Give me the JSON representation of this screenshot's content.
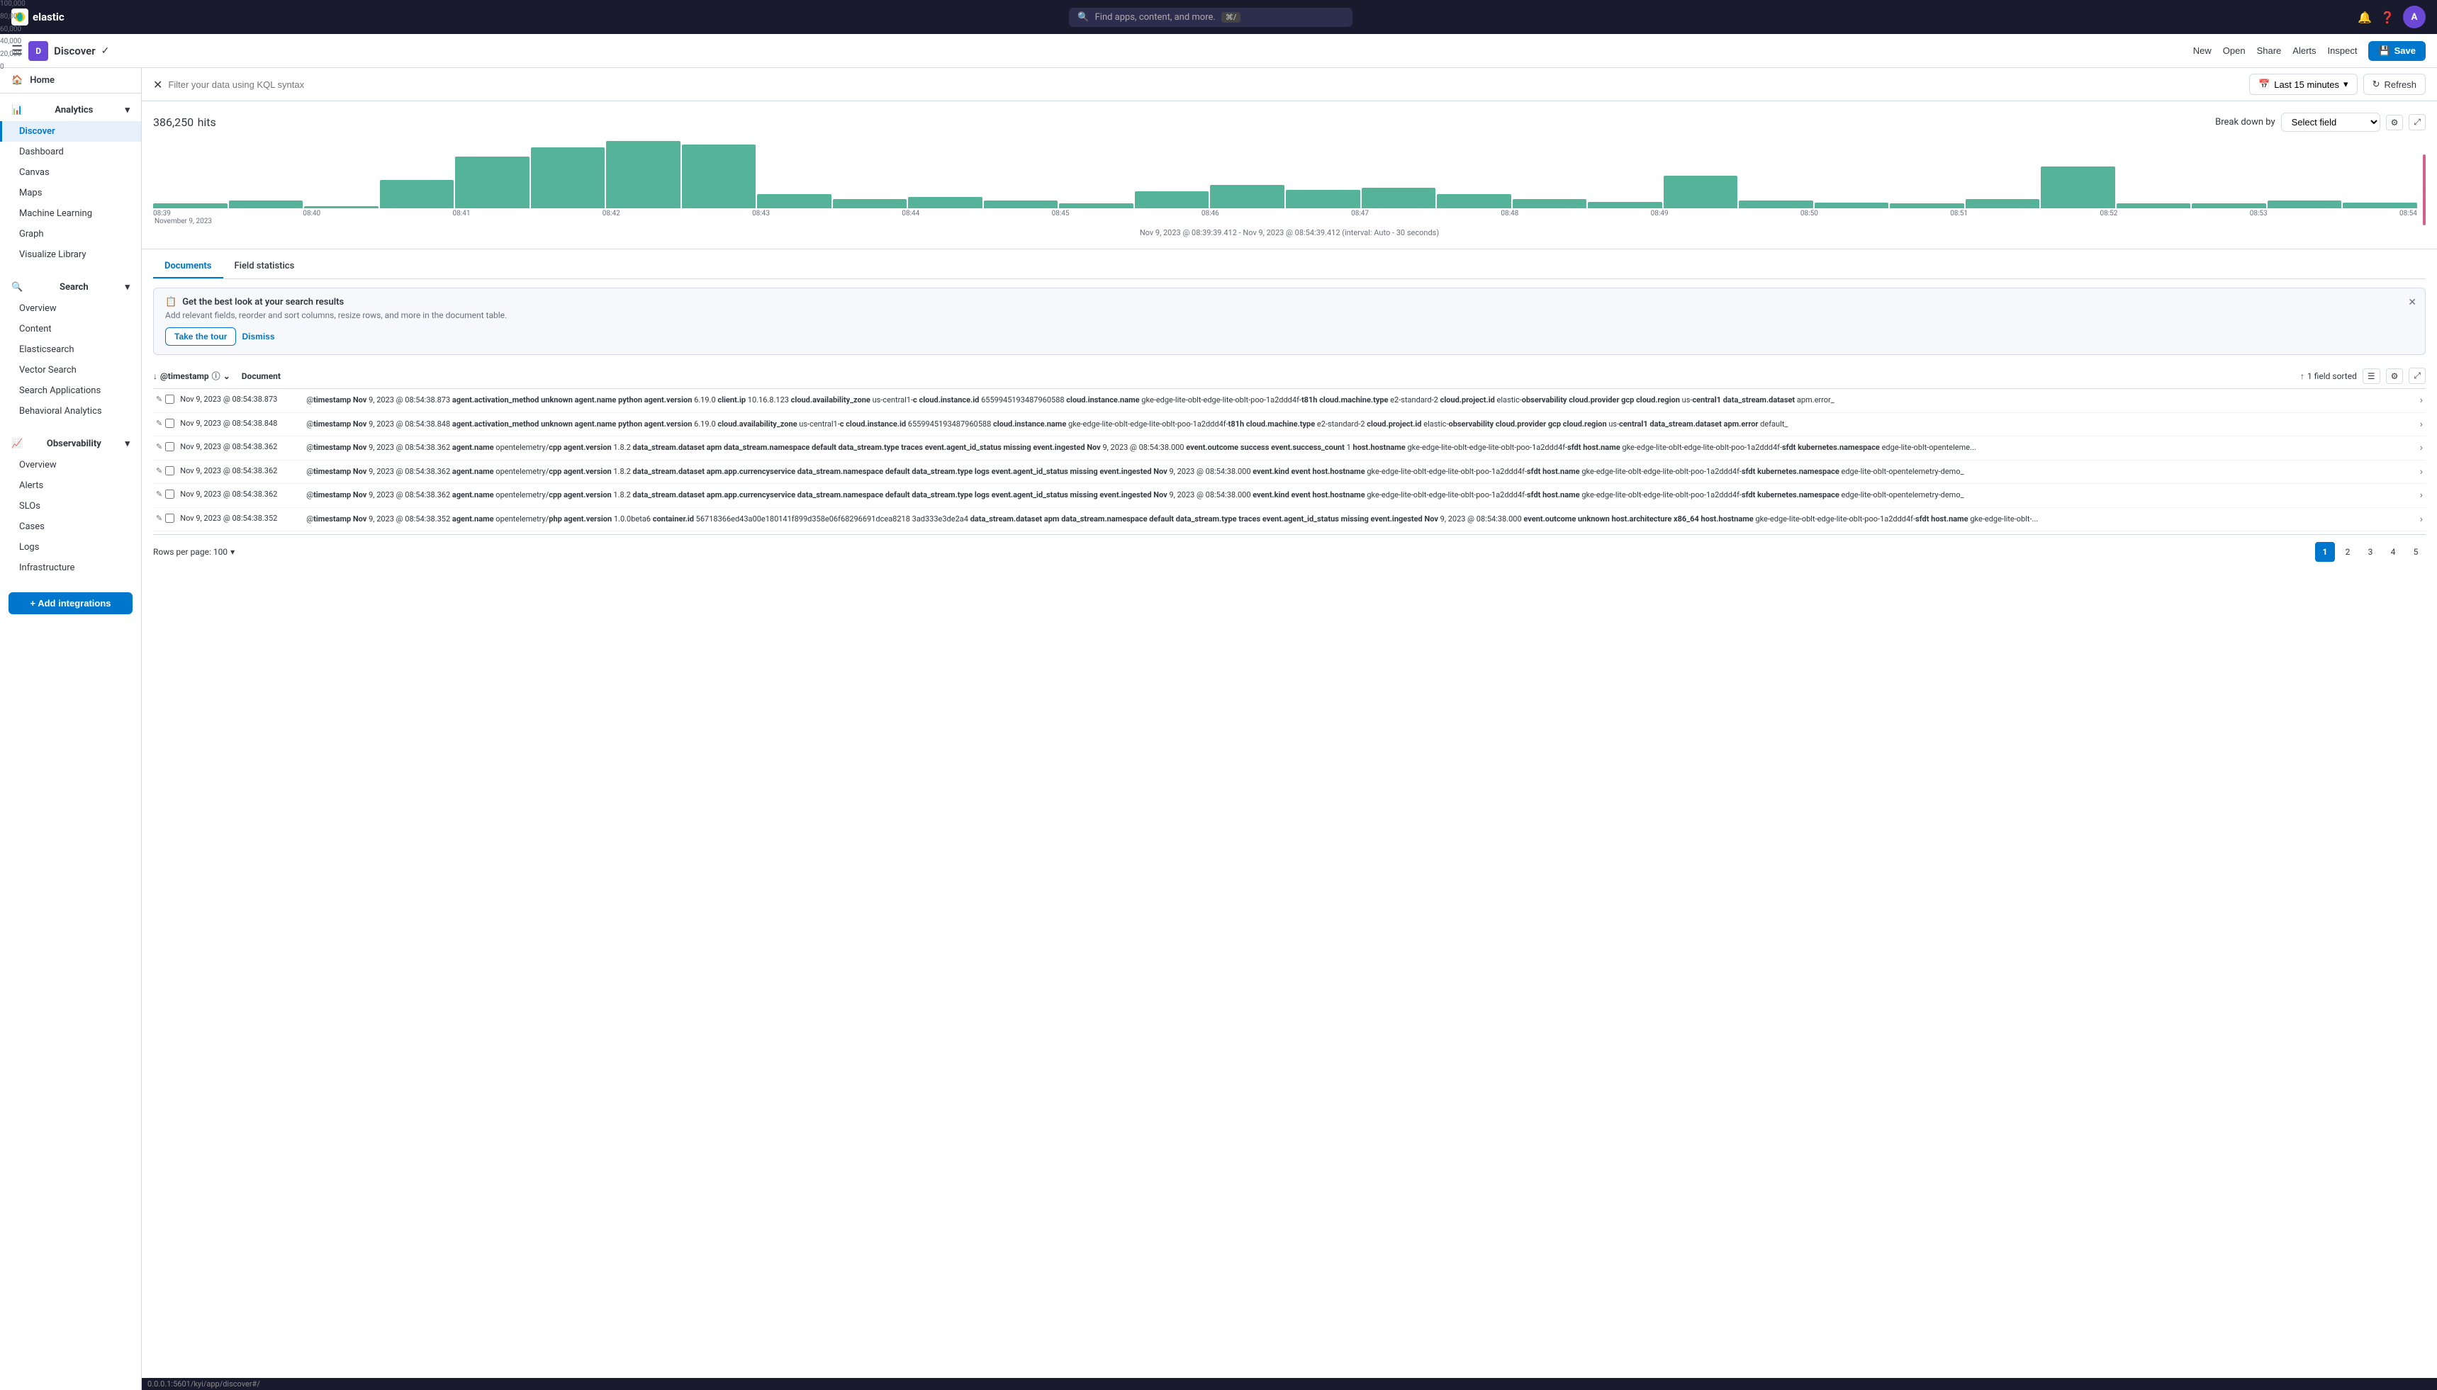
{
  "globalNav": {
    "logoText": "elastic",
    "searchPlaceholder": "Find apps, content, and more.",
    "searchShortcut": "⌘/",
    "avatarInitial": "A"
  },
  "appNav": {
    "avatarInitial": "D",
    "appName": "Discover",
    "actions": {
      "new": "New",
      "open": "Open",
      "share": "Share",
      "alerts": "Alerts",
      "inspect": "Inspect",
      "save": "Save"
    }
  },
  "sidebar": {
    "homeLabel": "Home",
    "sections": [
      {
        "name": "Analytics",
        "items": [
          "Discover",
          "Dashboard",
          "Canvas",
          "Maps",
          "Machine Learning",
          "Graph",
          "Visualize Library"
        ]
      },
      {
        "name": "Search",
        "items": [
          "Overview",
          "Content",
          "Elasticsearch",
          "Vector Search",
          "Search Applications",
          "Behavioral Analytics"
        ]
      },
      {
        "name": "Observability",
        "items": [
          "Overview",
          "Alerts",
          "SLOs",
          "Cases",
          "Logs",
          "Infrastructure"
        ]
      }
    ],
    "addIntegrationsLabel": "+ Add integrations"
  },
  "kqlBar": {
    "filterPlaceholder": "Filter your data using KQL syntax",
    "timePicker": "Last 15 minutes",
    "refreshLabel": "Refresh"
  },
  "chart": {
    "hits": "386,250",
    "hitsLabel": "hits",
    "breakdownByLabel": "Break down by",
    "selectFieldPlaceholder": "Select field",
    "timeRange": "Nov 9, 2023 @ 08:39:39.412 - Nov 9, 2023 @ 08:54:39.412 (interval: Auto - 30 seconds)",
    "yAxisLabels": [
      "100,000",
      "80,000",
      "60,000",
      "40,000",
      "20,000",
      "0"
    ],
    "xAxisLabels": [
      "08:39",
      "08:40",
      "08:41",
      "08:42",
      "08:43",
      "08:44",
      "08:45",
      "08:46",
      "08:47",
      "08:48",
      "08:49",
      "08:50",
      "08:51",
      "08:52",
      "08:53",
      "08:54"
    ],
    "xAxisDate": "November 9, 2023",
    "bars": [
      5,
      8,
      2,
      30,
      55,
      65,
      72,
      68,
      15,
      10,
      12,
      8,
      5,
      18,
      25,
      20,
      22,
      15,
      10,
      7,
      35,
      8,
      6,
      5,
      10,
      45,
      5,
      5,
      8,
      6
    ]
  },
  "tabs": {
    "documents": "Documents",
    "fieldStatistics": "Field statistics"
  },
  "banner": {
    "title": "Get the best look at your search results",
    "description": "Add relevant fields, reorder and sort columns, resize rows, and more in the document table.",
    "tourButton": "Take the tour",
    "dismissButton": "Dismiss"
  },
  "tableHeader": {
    "timestampCol": "@timestamp",
    "documentCol": "Document",
    "fieldSorted": "1 field sorted"
  },
  "rows": [
    {
      "timestamp": "Nov 9, 2023 @ 08:54:38.873",
      "content": "@timestamp Nov 9, 2023 @ 08:54:38.873 agent.activation_method unknown agent.name python agent.version 6.19.0 client.ip 10.16.8.123 cloud.availability_zone us-central1-c cloud.instance.id 6559945193487960588 cloud.instance.name gke-edge-lite-oblt-edge-lite-oblt-poo-1a2ddd4f-t81h cloud.machine.type e2-standard-2 cloud.project.id elastic-observability cloud.provider gcp cloud.region us-central1 data_stream.dataset apm.error_"
    },
    {
      "timestamp": "Nov 9, 2023 @ 08:54:38.848",
      "content": "@timestamp Nov 9, 2023 @ 08:54:38.848 agent.activation_method unknown agent.name python agent.version 6.19.0 cloud.availability_zone us-central1-c cloud.instance.id 6559945193487960588 cloud.instance.name gke-edge-lite-oblt-edge-lite-oblt-poo-1a2ddd4f-t81h cloud.machine.type e2-standard-2 cloud.project.id elastic-observability cloud.provider gcp cloud.region us-central1 data_stream.dataset apm.error default_"
    },
    {
      "timestamp": "Nov 9, 2023 @ 08:54:38.362",
      "content": "@timestamp Nov 9, 2023 @ 08:54:38.362 agent.name opentelemetry/cpp agent.version 1.8.2 data_stream.dataset apm data_stream.namespace default data_stream.type traces event.agent_id_status missing event.ingested Nov 9, 2023 @ 08:54:38.000 event.outcome success event.success_count 1 host.hostname gke-edge-lite-oblt-edge-lite-oblt-poo-1a2ddd4f-sfdt host.name gke-edge-lite-oblt-edge-lite-oblt-poo-1a2ddd4f-sfdt kubernetes.namespace edge-lite-oblt-openteleme..."
    },
    {
      "timestamp": "Nov 9, 2023 @ 08:54:38.362",
      "content": "@timestamp Nov 9, 2023 @ 08:54:38.362 agent.name opentelemetry/cpp agent.version 1.8.2 data_stream.dataset apm.app.currencyservice data_stream.namespace default data_stream.type logs event.agent_id_status missing event.ingested Nov 9, 2023 @ 08:54:38.000 event.kind event host.hostname gke-edge-lite-oblt-edge-lite-oblt-poo-1a2ddd4f-sfdt host.name gke-edge-lite-oblt-edge-lite-oblt-poo-1a2ddd4f-sfdt kubernetes.namespace edge-lite-oblt-opentelemetry-demo_"
    },
    {
      "timestamp": "Nov 9, 2023 @ 08:54:38.362",
      "content": "@timestamp Nov 9, 2023 @ 08:54:38.362 agent.name opentelemetry/cpp agent.version 1.8.2 data_stream.dataset apm.app.currencyservice data_stream.namespace default data_stream.type logs event.agent_id_status missing event.ingested Nov 9, 2023 @ 08:54:38.000 event.kind event host.hostname gke-edge-lite-oblt-edge-lite-oblt-poo-1a2ddd4f-sfdt host.name gke-edge-lite-oblt-edge-lite-oblt-poo-1a2ddd4f-sfdt kubernetes.namespace edge-lite-oblt-opentelemetry-demo_"
    },
    {
      "timestamp": "Nov 9, 2023 @ 08:54:38.352",
      "content": "@timestamp Nov 9, 2023 @ 08:54:38.352 agent.name opentelemetry/php agent.version 1.0.0beta6 container.id 56718366ed43a00e180141f899d358e06f68296691dcea8218 3ad333e3de2a4 data_stream.dataset apm data_stream.namespace default data_stream.type traces event.agent_id_status missing event.ingested Nov 9, 2023 @ 08:54:38.000 event.outcome unknown host.architecture x86_64 host.hostname gke-edge-lite-oblt-edge-lite-oblt-poo-1a2ddd4f-sfdt host.name gke-edge-lite-oblt-..."
    }
  ],
  "pagination": {
    "rowsPerPage": "Rows per page: 100",
    "pages": [
      "1",
      "2",
      "3",
      "4",
      "5"
    ],
    "currentPage": "1"
  },
  "urlBar": {
    "url": "0.0.0.1:5601/kyi/app/discover#/"
  }
}
